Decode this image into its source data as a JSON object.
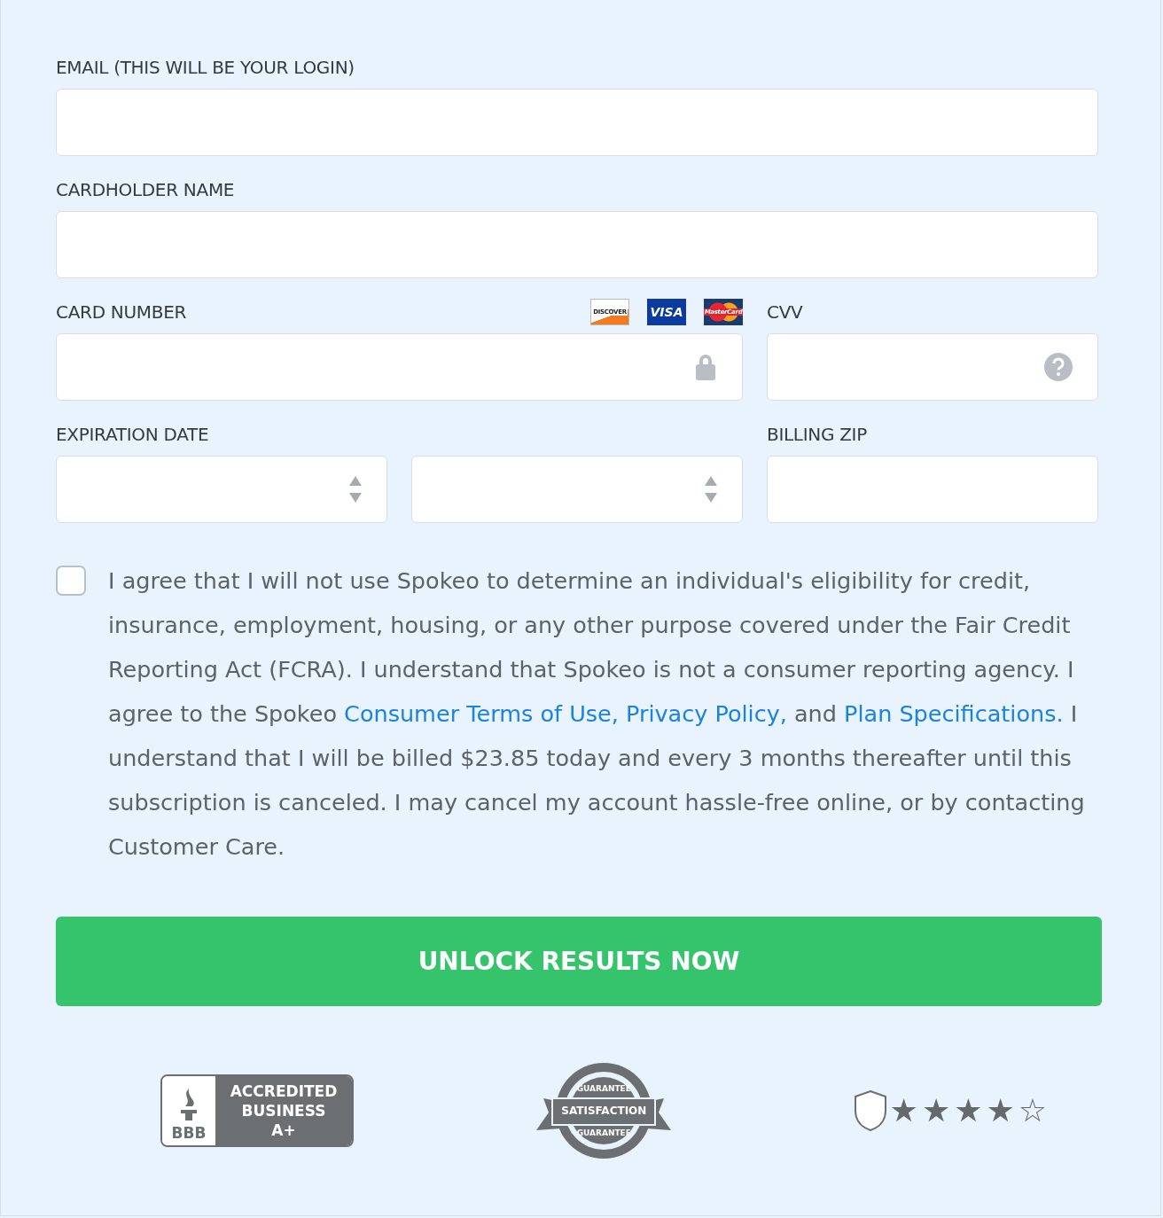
{
  "fields": [
    {
      "label": "EMAIL (THIS WILL BE YOUR LOGIN)"
    },
    {
      "label": "CARDHOLDER NAME"
    }
  ],
  "card_logos": [
    {
      "kind": "discover",
      "text": "DISCOVER"
    },
    {
      "kind": "visa",
      "text": "VISA"
    },
    {
      "kind": "mastercard",
      "text": "MasterCard"
    }
  ],
  "card_number": {
    "label": "CARD NUMBER"
  },
  "cvv": {
    "label": "CVV"
  },
  "expiration": {
    "label": "EXPIRATION DATE"
  },
  "billing_zip": {
    "label": "BILLING ZIP"
  },
  "agreement": {
    "checked": false,
    "parts": [
      {
        "kind": "text",
        "text": "I agree that I will not use Spokeo to determine an individual's eligibility for credit, insurance, employment, housing, or any other purpose covered under the Fair Credit Reporting Act (FCRA). I understand that Spokeo is not a consumer reporting agency. I agree to the Spokeo "
      },
      {
        "kind": "link",
        "text": "Consumer Terms of Use,"
      },
      {
        "kind": "link",
        "text": "Privacy Policy,"
      },
      {
        "kind": "text",
        "text": " and "
      },
      {
        "kind": "link",
        "text": "Plan Specifications."
      },
      {
        "kind": "text",
        "text": " I understand that I will be billed $23.85 today and every 3 months thereafter until this subscription is canceled. I may cancel my account hassle-free online, or by contacting Customer Care."
      }
    ]
  },
  "submit": "UNLOCK RESULTS NOW",
  "bbb": {
    "mark": "BBB",
    "lines": [
      "ACCREDITED",
      "BUSINESS",
      "A+"
    ]
  },
  "guarantee": {
    "main": "SATISFACTION",
    "top": "GUARANTEE",
    "bottom": "GUARANTEE"
  },
  "rating": {
    "stars": 4
  }
}
